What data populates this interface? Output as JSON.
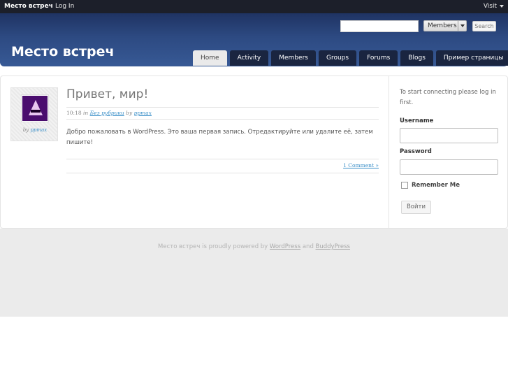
{
  "adminbar": {
    "site_name": "Место встреч",
    "login": "Log In",
    "visit": "Visit"
  },
  "header": {
    "title": "Место встреч",
    "search": {
      "value": "",
      "scope": "Members",
      "button": "Search"
    },
    "nav": [
      "Home",
      "Activity",
      "Members",
      "Groups",
      "Forums",
      "Blogs",
      "Пример страницы"
    ],
    "active_tab": "Home"
  },
  "post": {
    "title": "Привет, мир!",
    "meta": {
      "time": "10:18",
      "in": "in",
      "category": "Без рубрики",
      "by": "by",
      "author": "ppmax"
    },
    "body": "Добро пожаловать в WordPress. Это ваша первая запись. Отредактируйте или удалите её, затем пишите!",
    "comments": "1 Comment »",
    "author_box": {
      "by": "by",
      "author": "ppmax"
    }
  },
  "sidebar": {
    "intro": "To start connecting please log in first.",
    "username_label": "Username",
    "password_label": "Password",
    "remember_label": "Remember Me",
    "remember_checked": false,
    "login_button": "Войти"
  },
  "footer": {
    "prefix": "Место встреч is proudly powered by ",
    "wordpress": "WordPress",
    "and": " and ",
    "buddypress": "BuddyPress"
  },
  "colors": {
    "header_top": "#1f3363",
    "header_bottom": "#375995",
    "tab_bg": "#1a2540",
    "link": "#3a8fc8",
    "footer_bg": "#ebebeb"
  }
}
